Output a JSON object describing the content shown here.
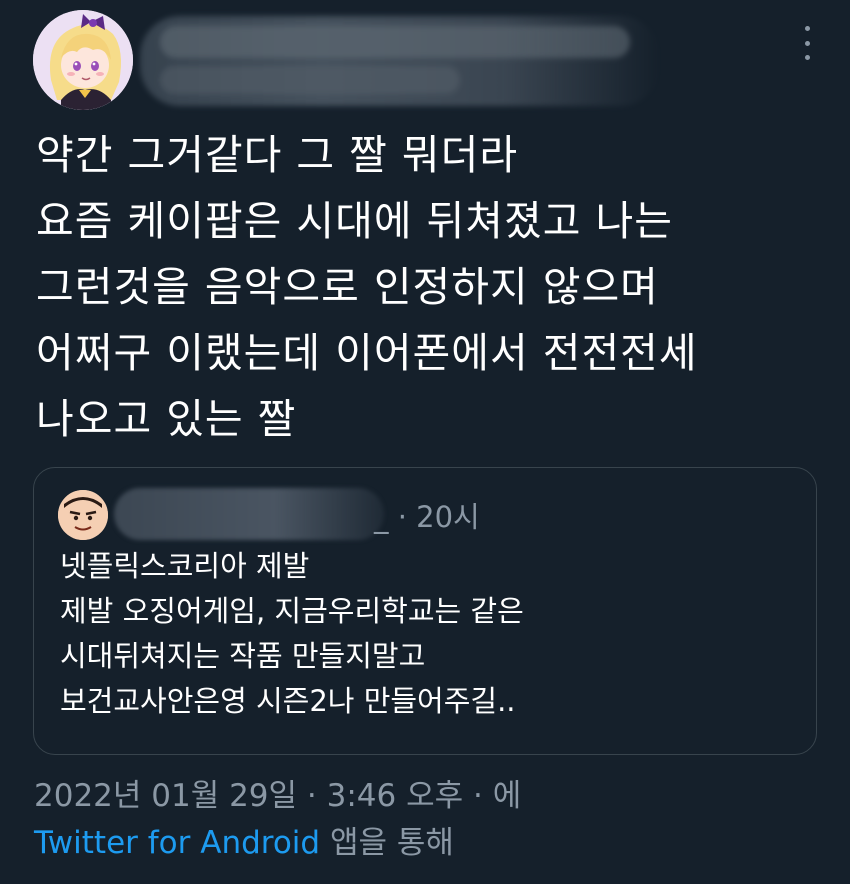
{
  "tweet": {
    "text_lines": [
      "약간 그거같다 그 짤 뭐더라",
      "요즘 케이팝은 시대에 뒤쳐졌고 나는",
      "그런것을 음악으로 인정하지 않으며",
      "어쩌구 이랬는데 이어폰에서 전전전세",
      "나오고 있는 짤"
    ],
    "more_icon": "more-vertical-icon"
  },
  "quote": {
    "name_suffix": "_",
    "separator": "·",
    "time": "20시",
    "text_lines": [
      "넷플릭스코리아 제발",
      "제발 오징어게임, 지금우리학교는 같은",
      "시대뒤쳐지는 작품 만들지말고",
      "보건교사안은영 시즌2나 만들어주길.."
    ]
  },
  "footer": {
    "date": "2022년 01월 29일",
    "sep1": "·",
    "time": "3:46 오후",
    "sep2": "·",
    "via_prefix": "에",
    "source": "Twitter for Android",
    "source_suffix": "앱을 통해"
  },
  "colors": {
    "background": "#15202b",
    "text": "#ffffff",
    "muted": "#8b98a5",
    "link": "#1d9bf0",
    "border": "#38444d"
  }
}
